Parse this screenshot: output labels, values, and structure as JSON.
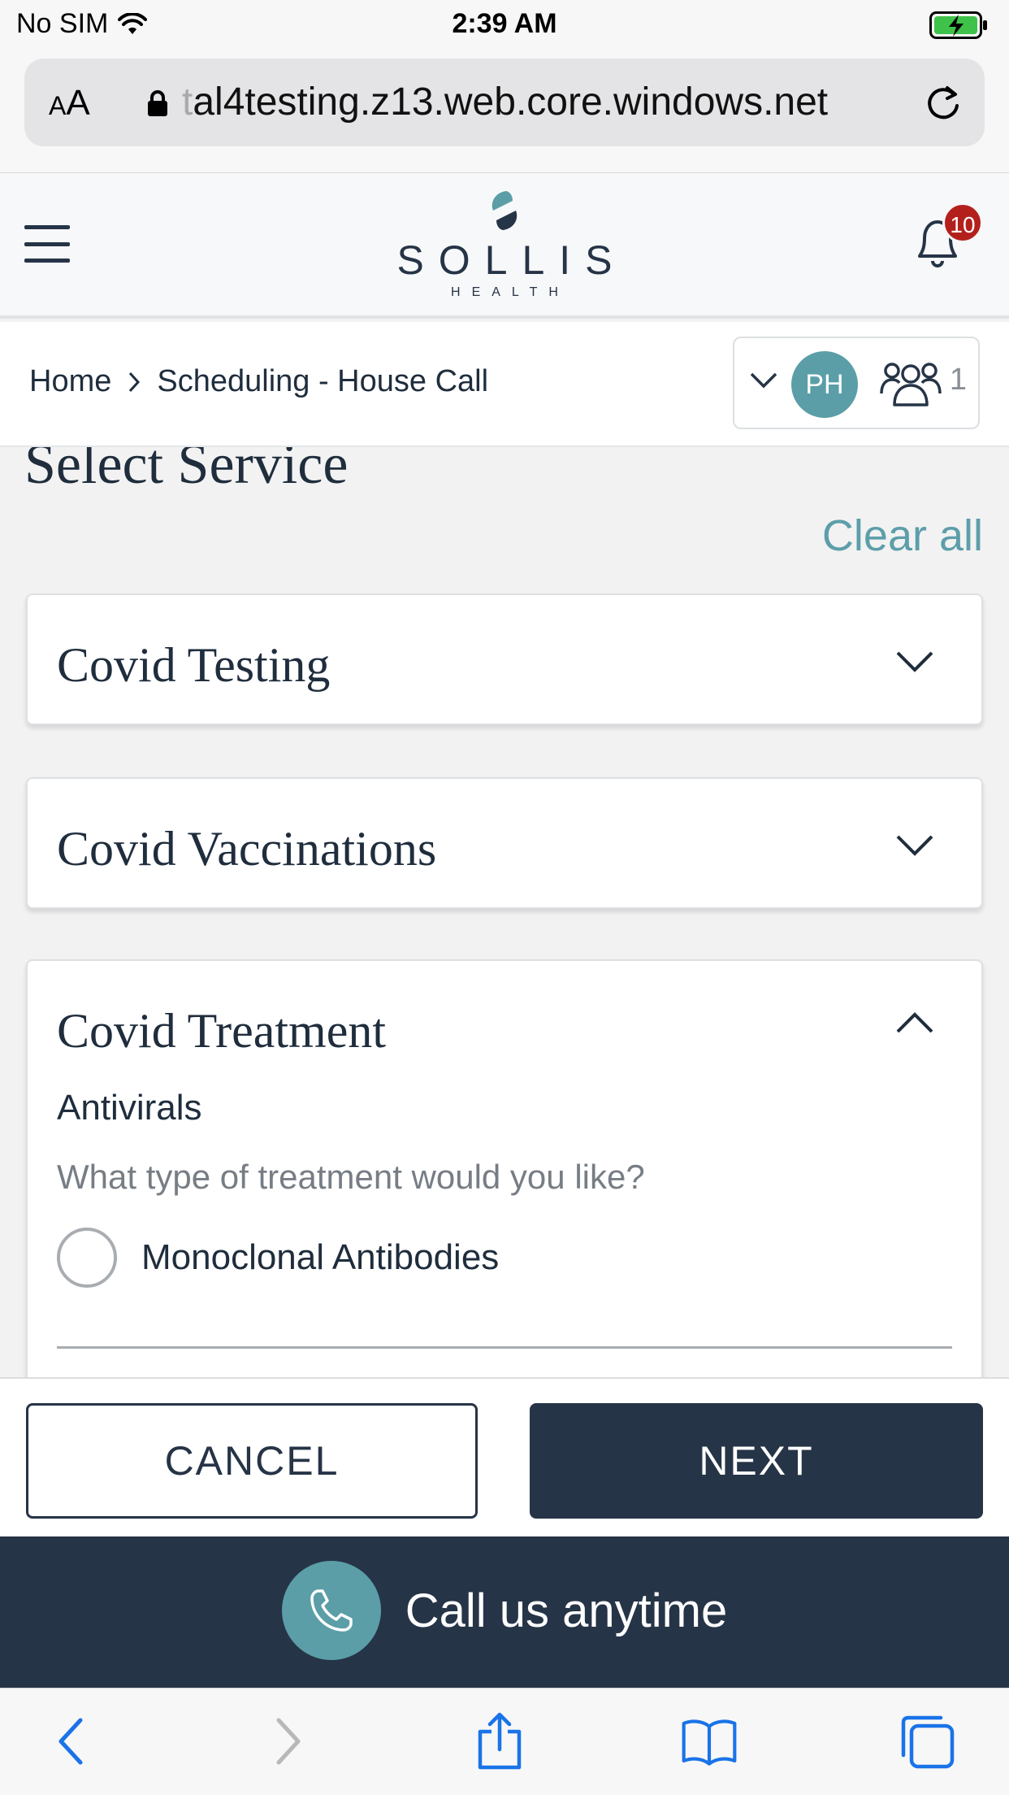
{
  "status_bar": {
    "carrier": "No SIM",
    "time": "2:39 AM"
  },
  "browser": {
    "text_size_small": "A",
    "text_size_large": "A",
    "url_faded": "t",
    "url": "al4testing.z13.web.core.windows.net"
  },
  "header": {
    "brand": "SOLLIS",
    "brand_sub": "HEALTH",
    "notification_count": "10"
  },
  "breadcrumb": {
    "items": [
      {
        "label": "Home"
      },
      {
        "label": "Scheduling - House Call"
      }
    ]
  },
  "profile": {
    "initials": "PH",
    "member_count": "1"
  },
  "main": {
    "title": "Select Service",
    "clear_all": "Clear all",
    "cards": [
      {
        "title": "Covid Testing",
        "expanded": false
      },
      {
        "title": "Covid Vaccinations",
        "expanded": false
      },
      {
        "title": "Covid Treatment",
        "expanded": true,
        "subtitle": "Antivirals",
        "question": "What type of treatment would you like?",
        "options": [
          {
            "label": "Monoclonal Antibodies",
            "selected": false
          }
        ]
      }
    ]
  },
  "actions": {
    "cancel": "CANCEL",
    "next": "NEXT"
  },
  "call_bar": {
    "text": "Call us anytime"
  },
  "colors": {
    "navy": "#263447",
    "teal": "#5b9ea8",
    "badge_red": "#b3201c",
    "link": "#5d9eaa"
  },
  "icons": {
    "status": [
      "wifi-icon",
      "battery-charging-icon"
    ],
    "toolbar": [
      "back-icon",
      "forward-icon",
      "share-icon",
      "bookmarks-icon",
      "tabs-icon"
    ]
  }
}
